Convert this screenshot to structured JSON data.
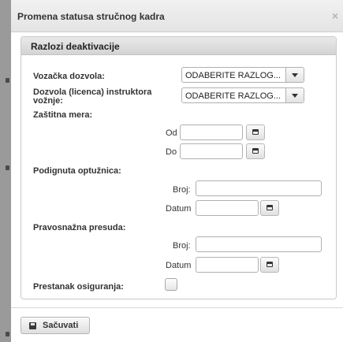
{
  "dialog": {
    "title": "Promena statusa stručnog kadra",
    "close_glyph": "×",
    "close_icon": "close-icon"
  },
  "panel": {
    "title": "Razlozi deaktivacije"
  },
  "form": {
    "vozacka_dozvola": {
      "label": "Vozačka dozvola:",
      "selected": "ODABERITE RAZLOG..."
    },
    "dozvola_instruktora": {
      "label_line1": "Dozvola (licenca) instruktora",
      "label_line2": "vožnje:",
      "selected": "ODABERITE RAZLOG..."
    },
    "zastitna_mera": {
      "label": "Zaštitna mera:",
      "od_label": "Od",
      "od_value": "",
      "do_label": "Do",
      "do_value": ""
    },
    "podignuta_optuznica": {
      "label": "Podignuta optužnica:",
      "broj_label": "Broj:",
      "broj_value": "",
      "datum_label": "Datum",
      "datum_value": ""
    },
    "pravosnazna_presuda": {
      "label": "Pravosnažna presuda:",
      "broj_label": "Broj:",
      "broj_value": "",
      "datum_label": "Datum",
      "datum_value": ""
    },
    "prestanak_osiguranja": {
      "label": "Prestanak osiguranja:",
      "checked": false
    }
  },
  "footer": {
    "save_label": "Sačuvati",
    "save_icon": "floppy-disk-icon"
  },
  "icons": {
    "calendar": "calendar-icon",
    "dropdown": "chevron-down-icon"
  },
  "colors": {
    "titlebar": "#e8e8e8",
    "panel_header": "#dcdcdc",
    "border": "#c9c9c9",
    "backdrop": "#9a9a9a"
  }
}
